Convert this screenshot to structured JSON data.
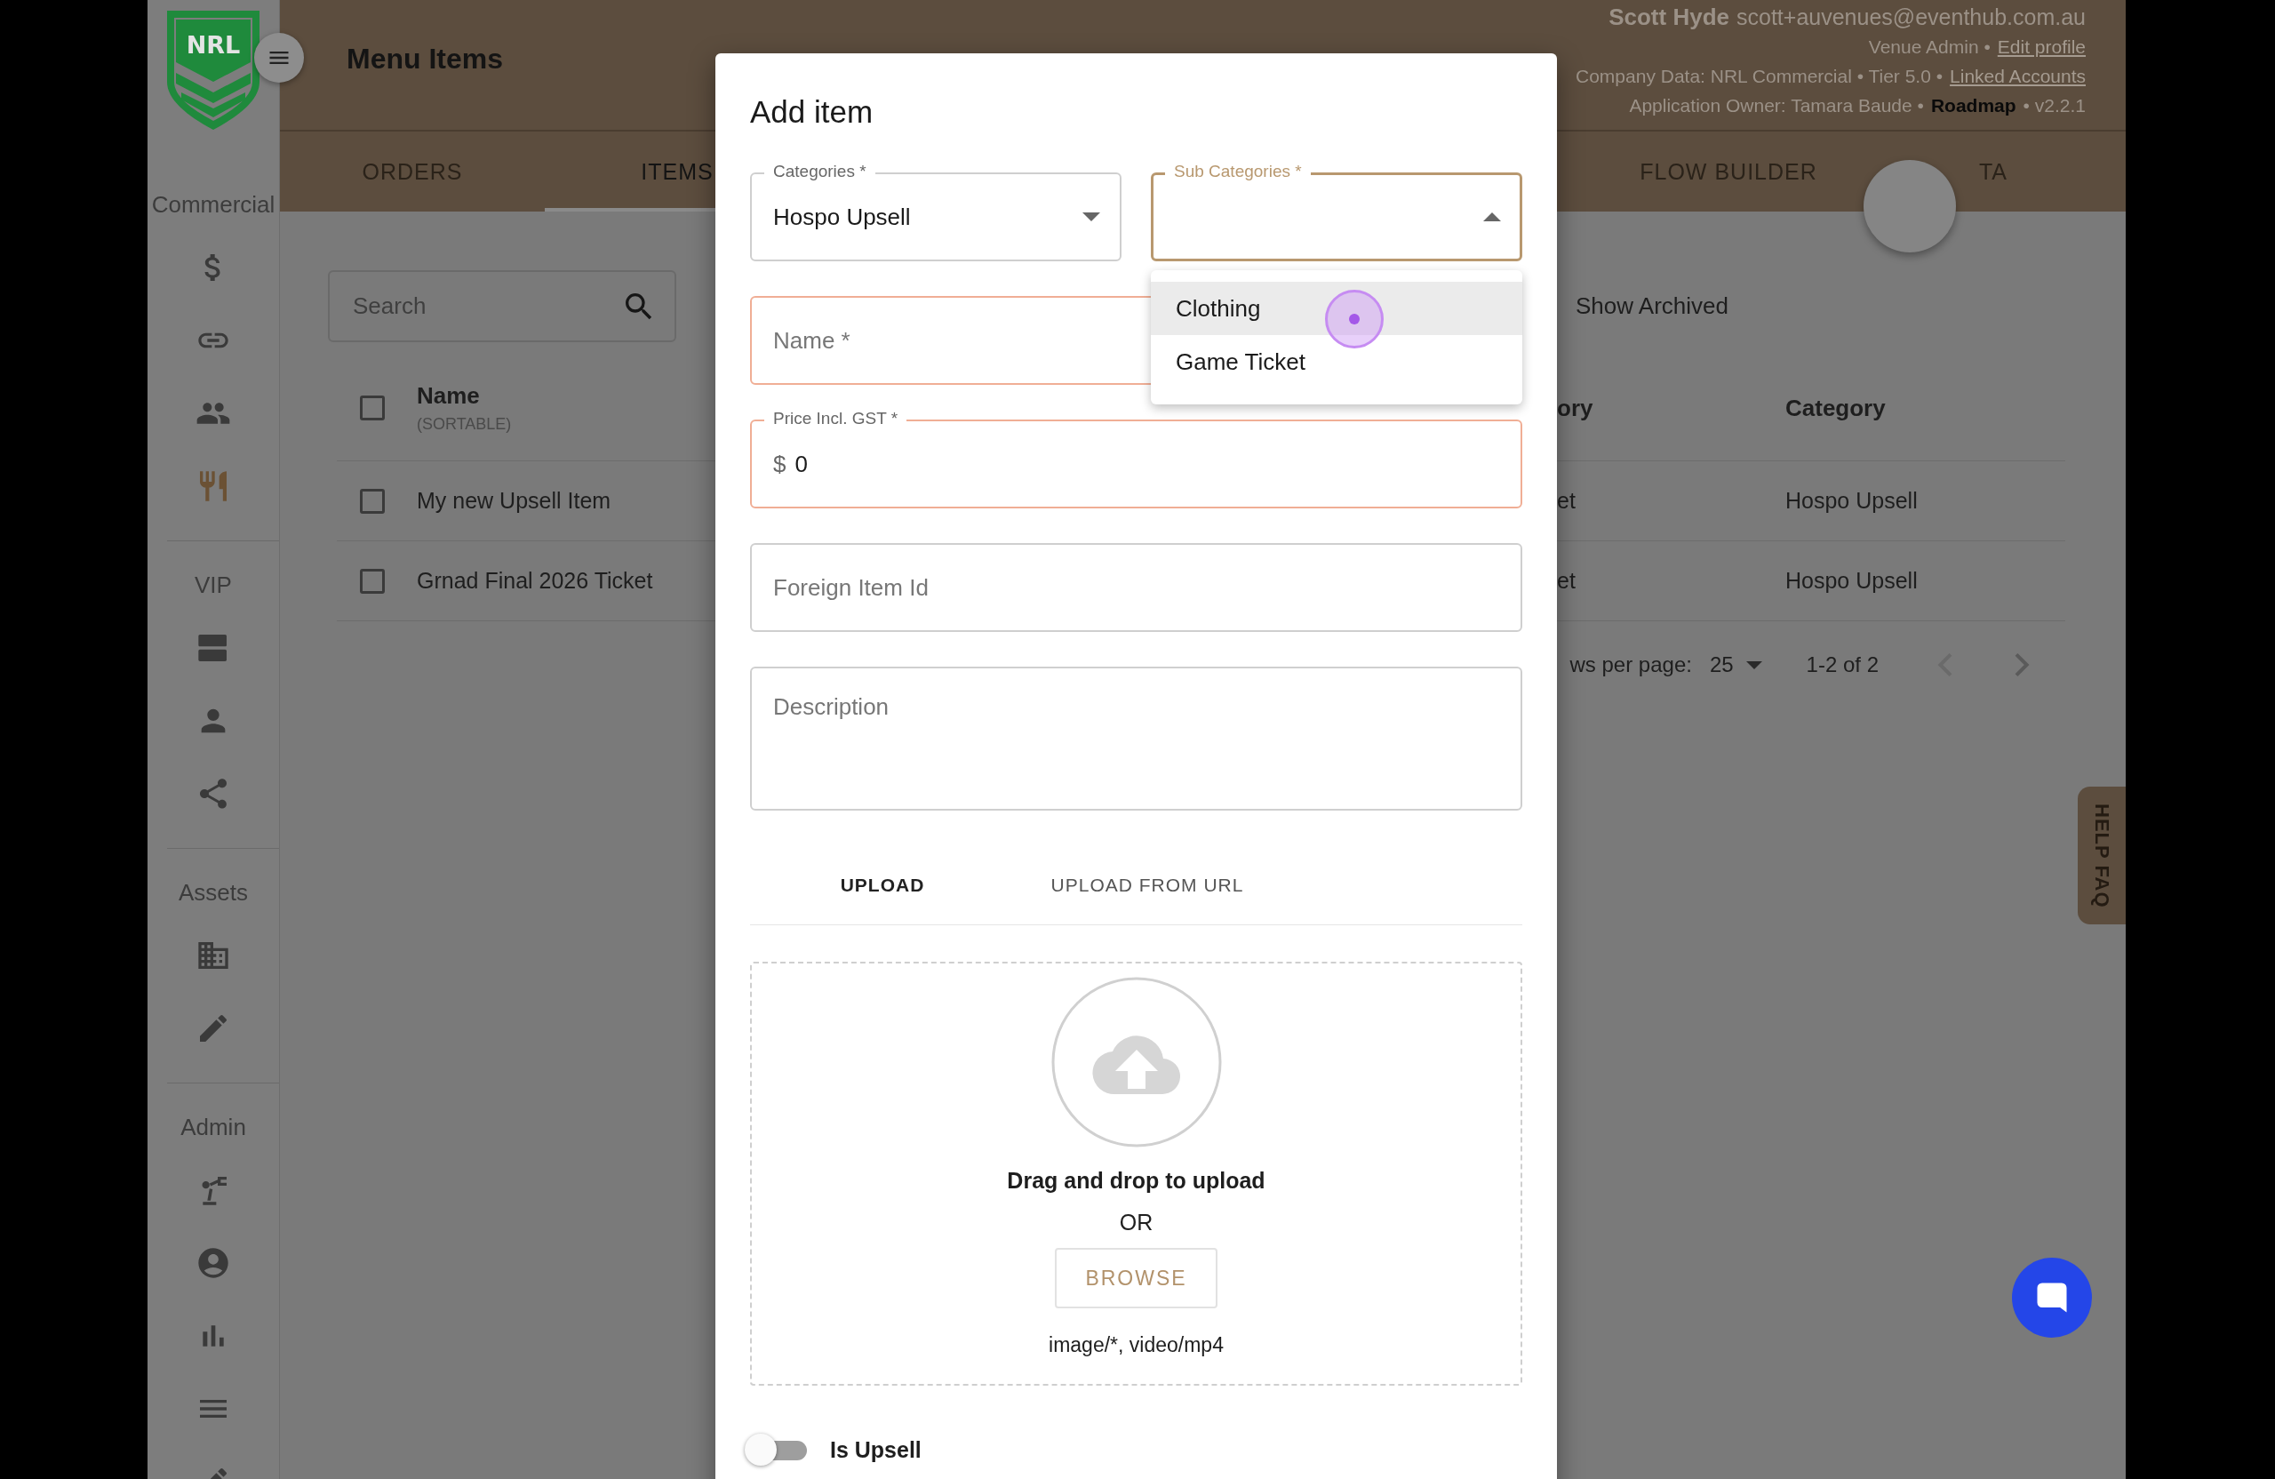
{
  "sidebar": {
    "logo_text": "NRL",
    "sections": [
      {
        "label": "Commercial",
        "items": [
          {
            "selected": false
          },
          {
            "selected": false
          },
          {
            "selected": false
          },
          {
            "selected": true
          }
        ]
      },
      {
        "label": "VIP",
        "items": [
          {
            "selected": false
          },
          {
            "selected": false
          },
          {
            "selected": false
          }
        ]
      },
      {
        "label": "Assets",
        "items": [
          {
            "selected": false
          },
          {
            "selected": false
          }
        ]
      },
      {
        "label": "Admin",
        "items": [
          {
            "selected": false
          },
          {
            "selected": false
          },
          {
            "selected": false
          },
          {
            "selected": false
          },
          {
            "selected": false
          }
        ]
      }
    ]
  },
  "header": {
    "title": "Menu Items",
    "user_name": "Scott Hyde",
    "email": "scott+auvenues@eventhub.com.au",
    "info_lines": [
      [
        {
          "kind": "text",
          "text": "Venue Admin •"
        },
        {
          "kind": "link",
          "text": "Edit profile"
        }
      ],
      [
        {
          "kind": "text",
          "text": "Company Data: NRL Commercial • Tier 5.0 •"
        },
        {
          "kind": "link",
          "text": "Linked Accounts"
        }
      ],
      [
        {
          "kind": "text",
          "text": "Application Owner: Tamara Baude •"
        },
        {
          "kind": "strong-link",
          "text": "Roadmap"
        },
        {
          "kind": "text",
          "text": "• v2.2.1"
        }
      ]
    ]
  },
  "tabs_left": [
    {
      "label": "ORDERS",
      "selected": false
    },
    {
      "label": "ITEMS",
      "selected": true
    }
  ],
  "tabs_right": [
    {
      "label": "FLOW BUILDER",
      "selected": false
    },
    {
      "label": "TA",
      "selected": false
    }
  ],
  "toolbar": {
    "search_placeholder": "Search",
    "show_archived": "Show Archived"
  },
  "table": {
    "header_checked": false,
    "columns": [
      {
        "label": "Name",
        "note": "(SORTABLE)"
      },
      {
        "label": "ory"
      },
      {
        "label": "Category"
      }
    ],
    "rows": [
      {
        "checked": false,
        "cells": [
          "My new Upsell Item",
          "et",
          "Hospo Upsell"
        ]
      },
      {
        "checked": false,
        "cells": [
          "Grnad Final 2026 Ticket",
          "et",
          "Hospo Upsell"
        ]
      }
    ]
  },
  "pagination": {
    "rows_label": "ws per page:",
    "rows_value": "25",
    "range": "1-2 of 2"
  },
  "help_tab": "HELP FAQ",
  "dialog": {
    "title": "Add item",
    "selects": [
      {
        "label": "Categories *",
        "value": "Hospo Upsell",
        "focused": false,
        "expanded": false
      },
      {
        "label": "Sub Categories *",
        "focused": true,
        "expanded": true
      }
    ],
    "dropdown": [
      {
        "label": "Clothing",
        "highlighted": true
      },
      {
        "label": "Game Ticket",
        "highlighted": false
      }
    ],
    "fields": [
      {
        "kind": "text",
        "placeholder": "Name *",
        "error": true
      },
      {
        "kind": "money",
        "label": "Price Incl. GST *",
        "prefix": "$",
        "value": "0",
        "error": true
      },
      {
        "kind": "text",
        "placeholder": "Foreign Item Id",
        "error": false
      },
      {
        "kind": "multiline",
        "placeholder": "Description",
        "error": false
      }
    ],
    "upload_tabs": [
      {
        "label": "UPLOAD",
        "selected": true
      },
      {
        "label": "UPLOAD FROM URL",
        "selected": false
      }
    ],
    "dropzone": {
      "heading": "Drag and drop to upload",
      "or": "OR",
      "button": "BROWSE",
      "accepted": "image/*, video/mp4"
    },
    "switch": {
      "label": "Is Upsell",
      "on": false
    }
  }
}
